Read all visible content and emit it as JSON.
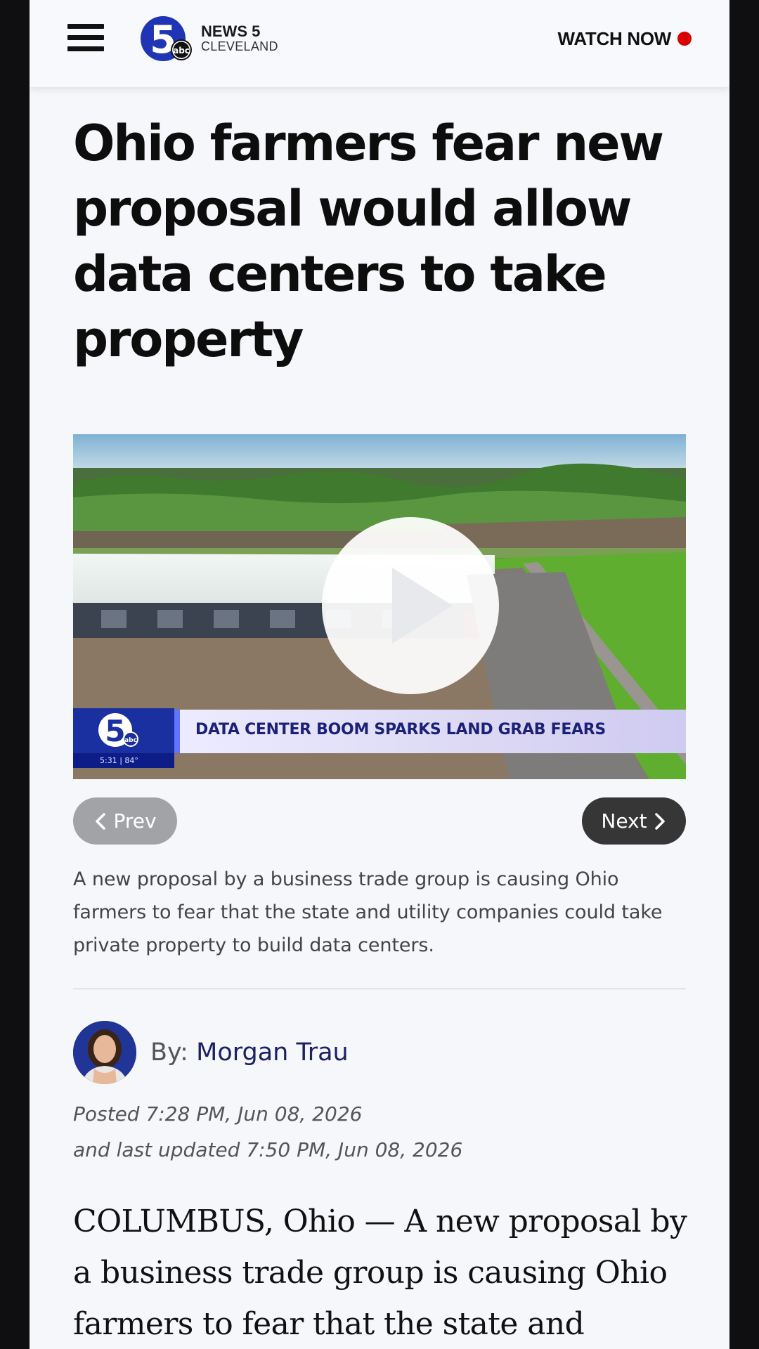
{
  "header": {
    "logo": {
      "title": "NEWS 5",
      "subtitle": "CLEVELAND",
      "mark_number": "5",
      "mark_network": "abc"
    },
    "watch_now_label": "WATCH NOW",
    "live_dot_color": "#d90000"
  },
  "article": {
    "headline": "Ohio farmers fear new proposal would allow data centers to take property",
    "video": {
      "lower_third_headline": "DATA CENTER BOOM SPARKS LAND GRAB FEARS",
      "lower_third_time": "5:31  |  84°",
      "lower_third_logo_number": "5",
      "lower_third_logo_network": "abc"
    },
    "nav": {
      "prev_label": "Prev",
      "next_label": "Next"
    },
    "caption": "A new proposal by a business trade group is causing Ohio farmers to fear that the state and utility companies could take private property to build data centers.",
    "byline": {
      "prefix": "By:",
      "author": "Morgan Trau"
    },
    "posted": "Posted 7:28 PM, Jun 08, 2026",
    "updated": "and last updated 7:50 PM, Jun 08, 2026",
    "body_lead": "COLUMBUS, Ohio — A new proposal by a business trade group is causing Ohio farmers to fear that the state and"
  },
  "colors": {
    "brand_blue": "#1a2fa0",
    "next_button": "#363636",
    "prev_button": "#a2a3a7",
    "author_link": "#1c2166"
  }
}
